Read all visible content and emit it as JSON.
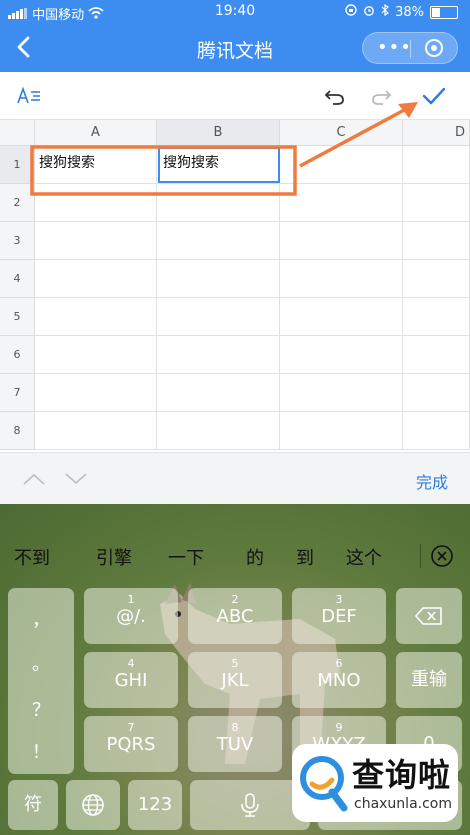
{
  "status": {
    "carrier": "中国移动",
    "time": "19:40",
    "battery": "38%",
    "battery_level": 0.38
  },
  "nav": {
    "title": "腾讯文档",
    "more": "•••"
  },
  "sheet": {
    "columns": [
      "A",
      "B",
      "C",
      "D"
    ],
    "rows": [
      "1",
      "2",
      "3",
      "4",
      "5",
      "6",
      "7",
      "8"
    ],
    "cell_A1": "搜狗搜索",
    "cell_B1": "搜狗搜索"
  },
  "panel": {
    "done": "完成"
  },
  "keyboard": {
    "candidates": [
      "不到",
      "引擎",
      "一下",
      "的",
      "到",
      "这个"
    ],
    "left_keys": [
      "，",
      "。",
      "？",
      "！"
    ],
    "row1": [
      {
        "num": "1",
        "lbl": "@/."
      },
      {
        "num": "2",
        "lbl": "ABC"
      },
      {
        "num": "3",
        "lbl": "DEF"
      }
    ],
    "row2": [
      {
        "num": "4",
        "lbl": "GHI"
      },
      {
        "num": "5",
        "lbl": "JKL"
      },
      {
        "num": "6",
        "lbl": "MNO"
      }
    ],
    "row3": [
      {
        "num": "7",
        "lbl": "PQRS"
      },
      {
        "num": "8",
        "lbl": "TUV"
      },
      {
        "num": "9",
        "lbl": "WXYZ"
      }
    ],
    "reinput": "重输",
    "zero_num": "0",
    "symbols": "符",
    "num_key": "123"
  },
  "watermark": {
    "name": "查询啦",
    "domain": "chaxunla.com"
  },
  "colors": {
    "accent": "#3d8cf0",
    "highlight": "#f07b3f",
    "link": "#2f7dd8"
  }
}
